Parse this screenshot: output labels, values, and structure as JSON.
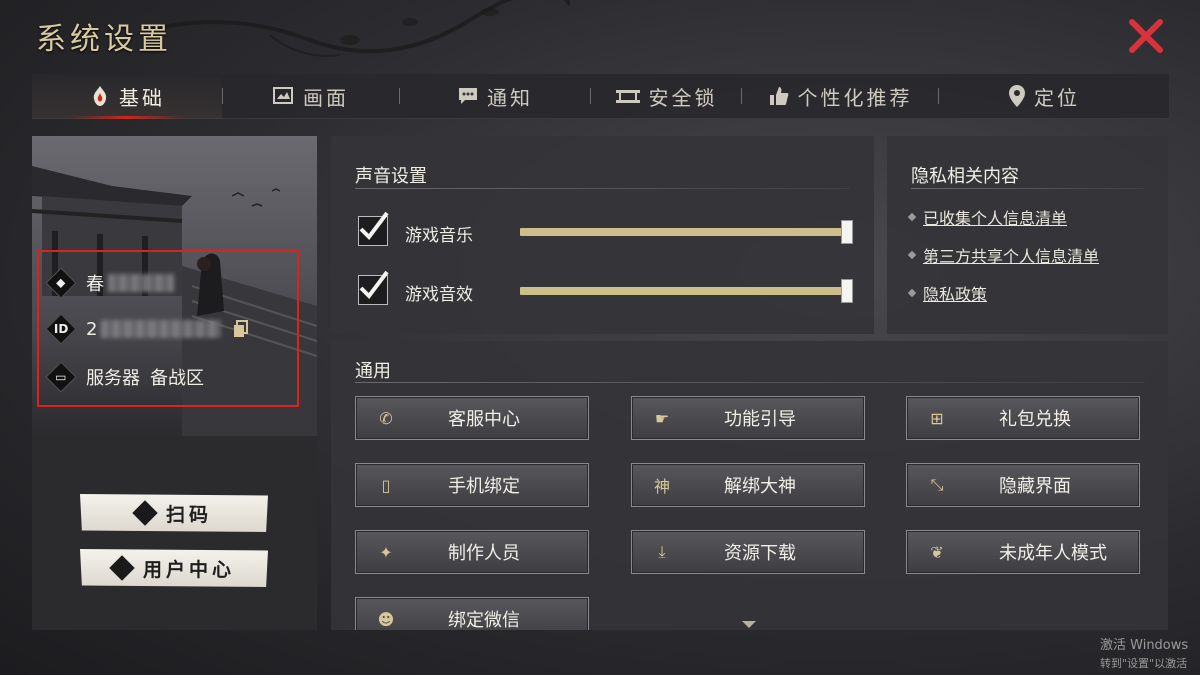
{
  "title": "系统设置",
  "tabs": [
    {
      "label": "基础",
      "icon": "flame-emblem-icon",
      "active": true
    },
    {
      "label": "画面",
      "icon": "screen-icon",
      "active": false
    },
    {
      "label": "通知",
      "icon": "chat-bubble-icon",
      "active": false
    },
    {
      "label": "安全锁",
      "icon": "lock-bar-icon",
      "active": false
    },
    {
      "label": "个性化推荐",
      "icon": "thumbs-up-icon",
      "active": false
    },
    {
      "label": "定位",
      "icon": "location-pin-icon",
      "active": false
    }
  ],
  "profile": {
    "name_visible": "春",
    "id_prefix": "ID",
    "id_visible": "2",
    "server_label": "服务器",
    "server_value": "备战区"
  },
  "left_buttons": {
    "scan": "扫码",
    "user_center": "用户中心"
  },
  "sound": {
    "title": "声音设置",
    "music_label": "游戏音乐",
    "music_checked": true,
    "music_level": 1.0,
    "sfx_label": "游戏音效",
    "sfx_checked": true,
    "sfx_level": 1.0
  },
  "privacy": {
    "title": "隐私相关内容",
    "items": [
      "已收集个人信息清单",
      "第三方共享个人信息清单",
      "隐私政策"
    ]
  },
  "general": {
    "title": "通用",
    "buttons": [
      {
        "label": "客服中心",
        "icon": "phone-icon"
      },
      {
        "label": "功能引导",
        "icon": "pointing-hand-icon"
      },
      {
        "label": "礼包兑换",
        "icon": "gift-icon"
      },
      {
        "label": "手机绑定",
        "icon": "mobile-icon"
      },
      {
        "label": "解绑大神",
        "icon": "shen-glyph-icon",
        "glyph": "神"
      },
      {
        "label": "隐藏界面",
        "icon": "diagonal-arrows-icon"
      },
      {
        "label": "制作人员",
        "icon": "team-icon"
      },
      {
        "label": "资源下载",
        "icon": "download-icon"
      },
      {
        "label": "未成年人模式",
        "icon": "shield-emblem-icon"
      },
      {
        "label": "绑定微信",
        "icon": "wechat-icon"
      }
    ]
  },
  "watermark": {
    "line1": "激活 Windows",
    "line2": "转到\"设置\"以激活"
  },
  "colors": {
    "accent_red": "#c8281e",
    "title_gold": "#d8c9a0",
    "slider_fill": "#cdbf8c",
    "close_red": "#d8323a"
  }
}
